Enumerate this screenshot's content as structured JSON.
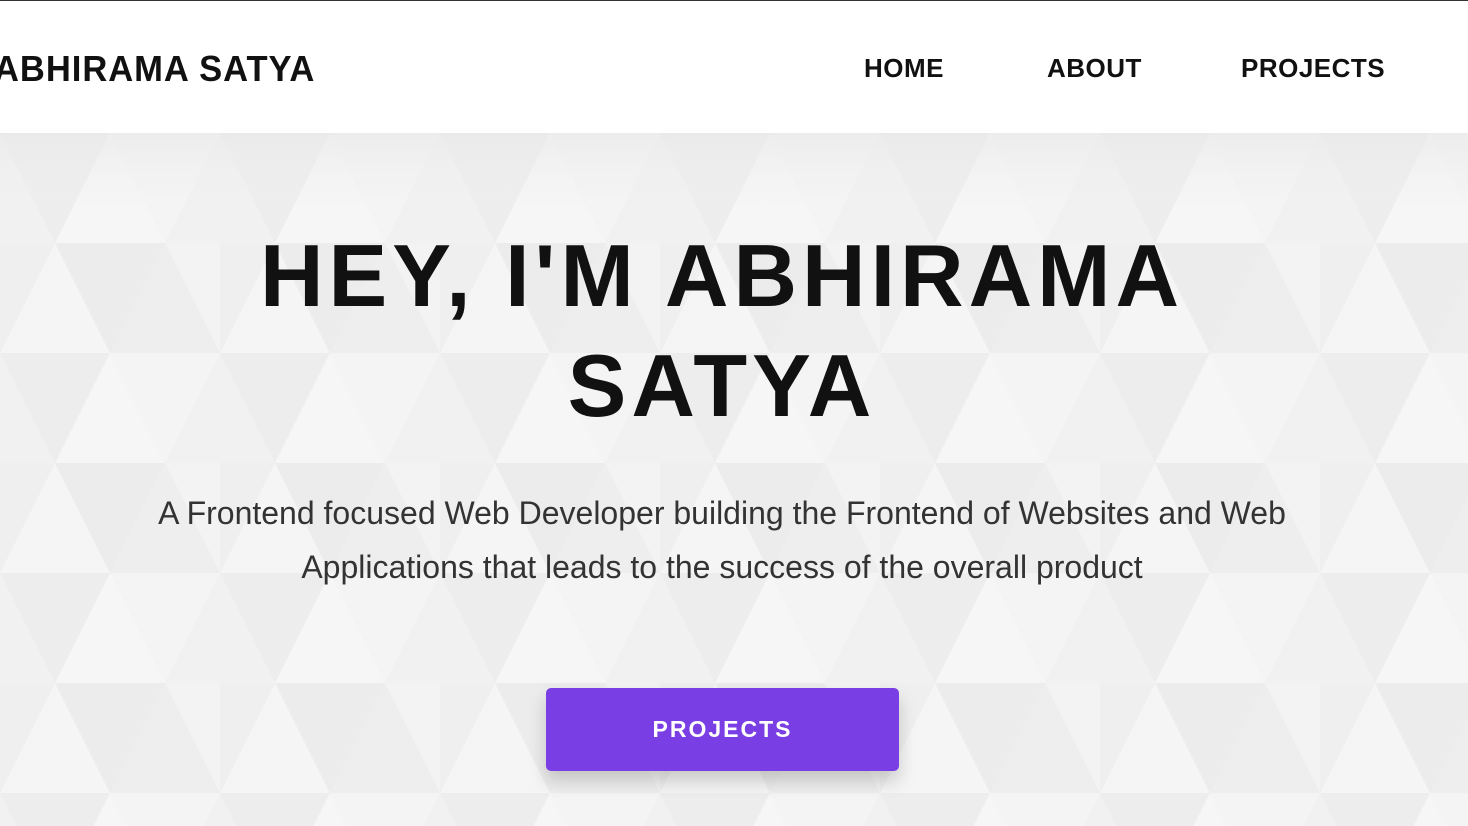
{
  "header": {
    "brand": "ABHIRAMA SATYA",
    "nav": {
      "home": "HOME",
      "about": "ABOUT",
      "projects": "PROJECTS"
    }
  },
  "hero": {
    "title_line1": "HEY, I'M ABHIRAMA",
    "title_line2": "SATYA",
    "subtitle_line1": "A Frontend focused Web Developer building the Frontend of Websites and Web",
    "subtitle_line2": "Applications that leads to the success of the overall product",
    "cta_label": "PROJECTS"
  },
  "colors": {
    "accent": "#7a3fe4",
    "text": "#111111",
    "background": "#f2f2f2"
  }
}
